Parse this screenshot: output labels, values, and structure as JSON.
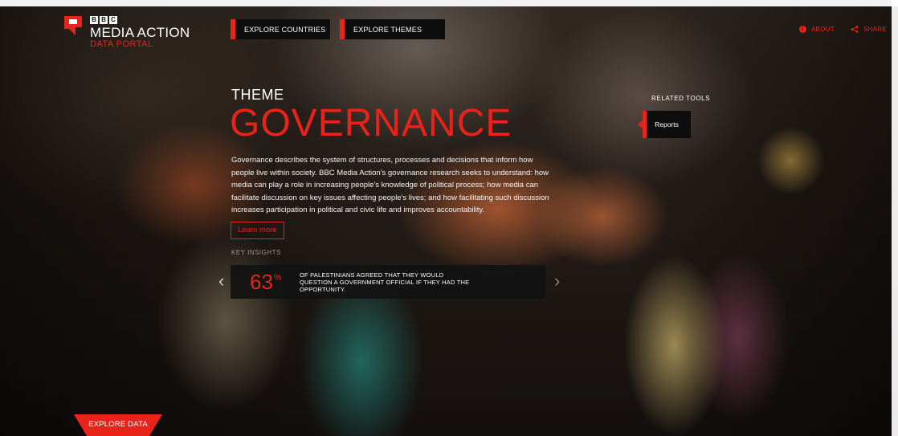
{
  "brand": {
    "bbc_letters": [
      "B",
      "B",
      "C"
    ],
    "name": "MEDIA ACTION",
    "subtitle": "DATA PORTAL"
  },
  "nav": {
    "items": [
      {
        "label": "EXPLORE COUNTRIES"
      },
      {
        "label": "EXPLORE THEMES"
      }
    ]
  },
  "top_right": {
    "about_label": "ABOUT",
    "share_label": "SHARE"
  },
  "theme": {
    "label": "THEME",
    "title": "GOVERNANCE",
    "description": "Governance describes the system of structures, processes and decisions that inform how people live within society. BBC Media Action's governance research seeks to understand: how media can play a role in increasing people's knowledge of political process; how media can facilitate discussion on key issues affecting people's lives; and how facilitating such discussion increases participation in political and civic life and improves accountability.",
    "learn_more_label": "Learn more",
    "key_insights_label": "KEY INSIGHTS"
  },
  "insight": {
    "value": "63",
    "unit": "%",
    "text": "OF PALESTINIANS AGREED THAT THEY WOULD QUESTION A GOVERNMENT OFFICIAL IF THEY HAD THE OPPORTUNITY."
  },
  "related_tools": {
    "label": "RELATED TOOLS",
    "items": [
      {
        "label": "Reports"
      }
    ]
  },
  "explore_data_label": "EXPLORE DATA",
  "colors": {
    "accent": "#e8231a",
    "panel": "#0d0d0d",
    "text": "#ffffff"
  },
  "icons": [
    "logo-mark-icon",
    "info-icon",
    "share-icon",
    "chevron-left-icon",
    "chevron-right-icon"
  ]
}
